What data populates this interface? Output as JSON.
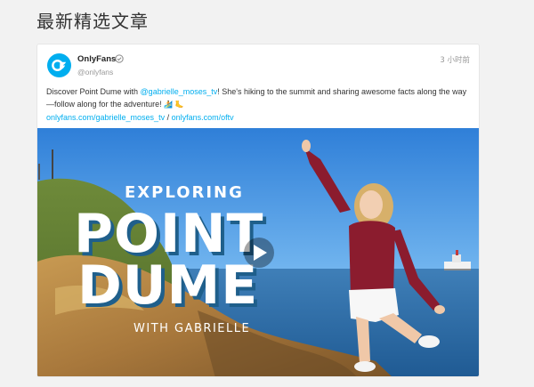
{
  "section": {
    "title": "最新精选文章"
  },
  "post": {
    "account_name": "OnlyFans",
    "account_handle": "@onlyfans",
    "time": "3 小时前",
    "text_before": "Discover Point Dume with ",
    "mention": "@gabrielle_moses_tv",
    "text_after": "! She's hiking to the summit and sharing awesome facts along the way—follow along for the adventure!",
    "emojis": "🏄 🦶",
    "link1": "onlyfans.com/gabrielle_moses_tv",
    "separator": " / ",
    "link2": "onlyfans.com/oftv"
  },
  "thumbnail": {
    "line1": "EXPLORING",
    "line2": "POINT",
    "line3": "DUME",
    "line4": "WITH GABRIELLE",
    "play_icon": "play-icon"
  },
  "colors": {
    "brand": "#00aeef",
    "link": "#00aeef",
    "background": "#f2f2f2"
  }
}
